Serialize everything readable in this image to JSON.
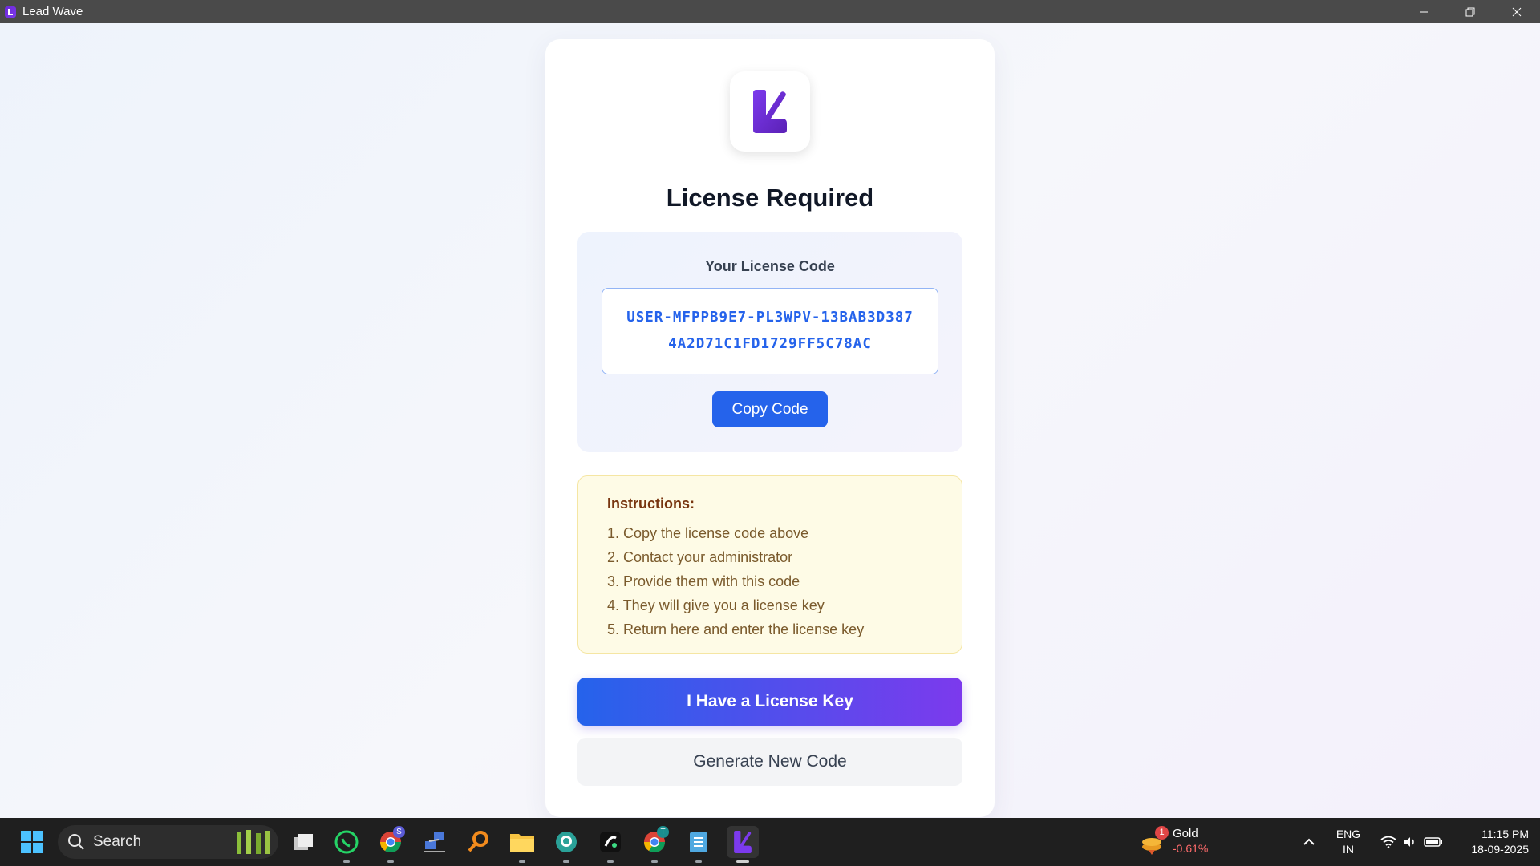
{
  "window": {
    "title": "Lead Wave"
  },
  "card": {
    "heading": "License Required",
    "code_label": "Your License Code",
    "code_line1": "USER-MFPPB9E7-PL3WPV-13BAB3D387",
    "code_line2": "4A2D71C1FD1729FF5C78AC",
    "copy_label": "Copy Code",
    "instructions_title": "Instructions:",
    "instructions": [
      "1. Copy the license code above",
      "2. Contact your administrator",
      "3. Provide them with this code",
      "4. They will give you a license key",
      "5. Return here and enter the license key"
    ],
    "primary_label": "I Have a License Key",
    "secondary_label": "Generate New Code"
  },
  "taskbar": {
    "search_label": "Search",
    "chrome_badge": "S",
    "chrome2_badge": "T",
    "widget_badge": "1",
    "widget_name": "Gold",
    "widget_value": "-0.61%",
    "lang_top": "ENG",
    "lang_bottom": "IN",
    "time": "11:15 PM",
    "date": "18-09-2025"
  },
  "colors": {
    "accent": "#2563eb",
    "brand": "#7c3aed",
    "negative": "#ff6b6b"
  }
}
